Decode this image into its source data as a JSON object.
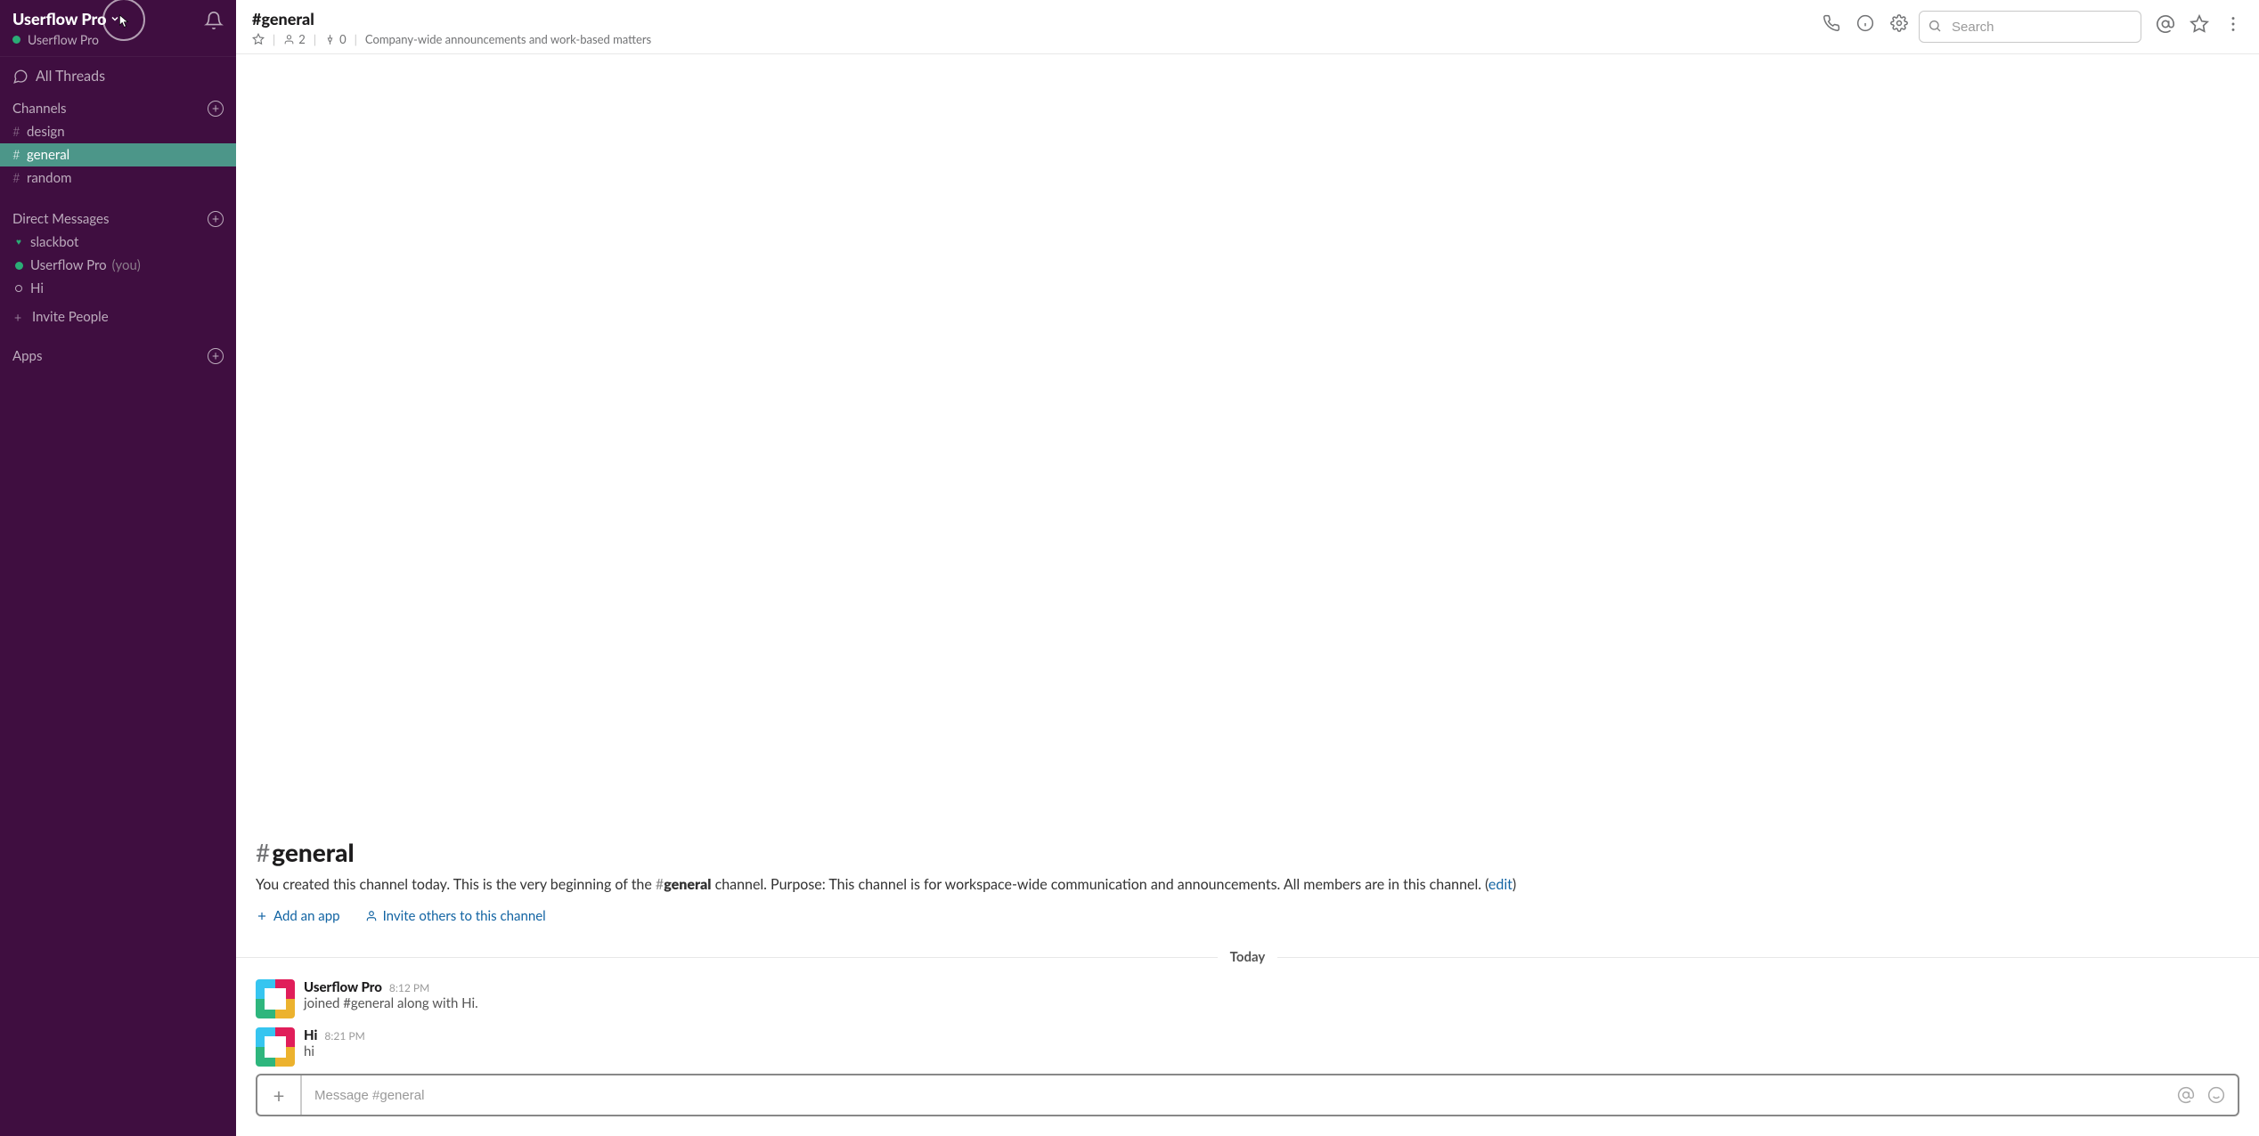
{
  "workspace": {
    "name": "Userflow Pro",
    "user_name": "Userflow Pro"
  },
  "sidebar": {
    "all_threads": "All Threads",
    "channels_heading": "Channels",
    "channels": [
      {
        "name": "design"
      },
      {
        "name": "general"
      },
      {
        "name": "random"
      }
    ],
    "dms_heading": "Direct Messages",
    "dms": [
      {
        "name": "slackbot",
        "presence": "heart"
      },
      {
        "name": "Userflow Pro",
        "presence": "active",
        "you_suffix": "(you)"
      },
      {
        "name": "Hi",
        "presence": "away"
      }
    ],
    "invite_people": "Invite People",
    "apps_heading": "Apps"
  },
  "header": {
    "channel_name": "#general",
    "member_count": "2",
    "pin_count": "0",
    "topic": "Company-wide announcements and work-based matters",
    "search_placeholder": "Search"
  },
  "intro": {
    "hash": "#",
    "title": "general",
    "body_prefix": "You created this channel today. This is the very beginning of the ",
    "channel_ref_hash": "#",
    "channel_ref_name": "general",
    "body_mid": " channel. Purpose: This channel is for workspace-wide communication and announcements. All members are in this channel. (",
    "edit_link": "edit",
    "body_suffix": ")",
    "add_app": "Add an app",
    "invite_others": "Invite others to this channel"
  },
  "date_divider": "Today",
  "messages": [
    {
      "user": "Userflow Pro",
      "time": "8:12 PM",
      "text": "joined #general along with Hi."
    },
    {
      "user": "Hi",
      "time": "8:21 PM",
      "text": "hi"
    }
  ],
  "composer": {
    "placeholder": "Message #general"
  }
}
